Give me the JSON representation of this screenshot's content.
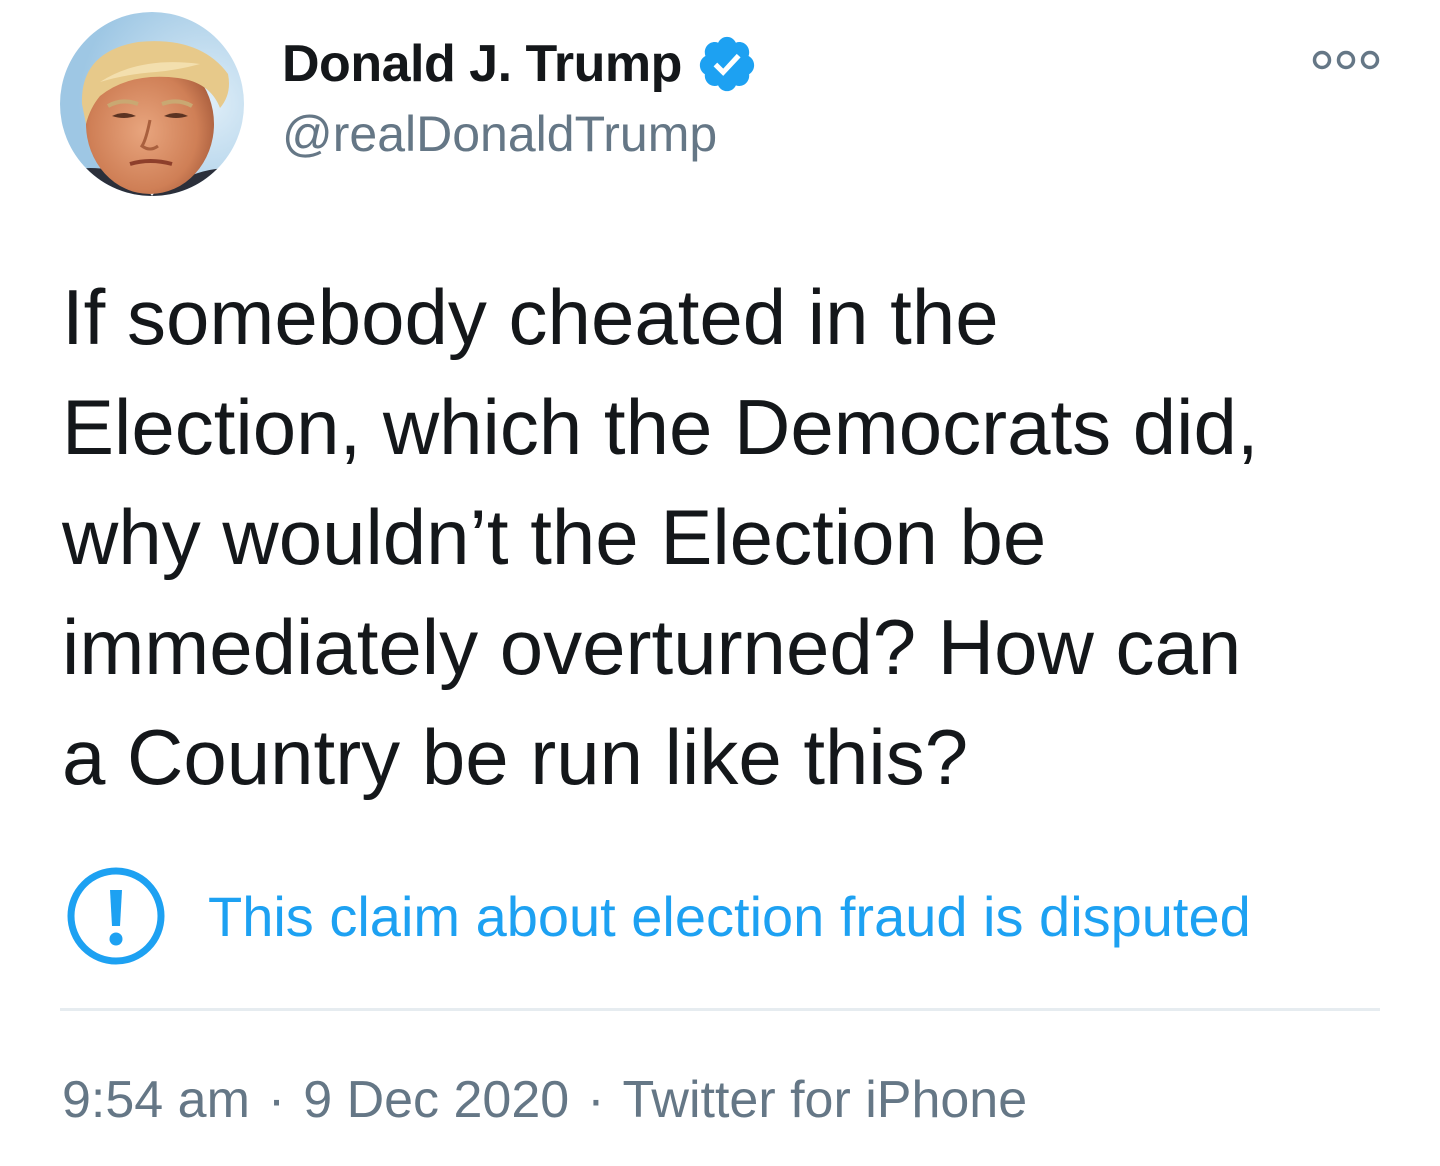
{
  "colors": {
    "text_primary": "#14171a",
    "text_secondary": "#657786",
    "accent_blue": "#1da1f2",
    "divider": "#e6ecf0"
  },
  "author": {
    "display_name": "Donald J. Trump",
    "handle": "@realDonaldTrump",
    "verified": true,
    "avatar_icon": "profile-photo-avatar",
    "verified_icon": "verified-badge-icon"
  },
  "menu": {
    "icon": "more-options-icon"
  },
  "tweet": {
    "text": "If somebody cheated in the\nElection, which the Democrats did,\nwhy wouldn’t the Election be\nimmediately overturned? How can\na Country be run like this?"
  },
  "notice": {
    "icon": "exclamation-circle-icon",
    "text": "This claim about election fraud is disputed"
  },
  "meta": {
    "time": "9:54 am",
    "separator": "·",
    "date": "9 Dec 2020",
    "source": "Twitter for iPhone"
  }
}
